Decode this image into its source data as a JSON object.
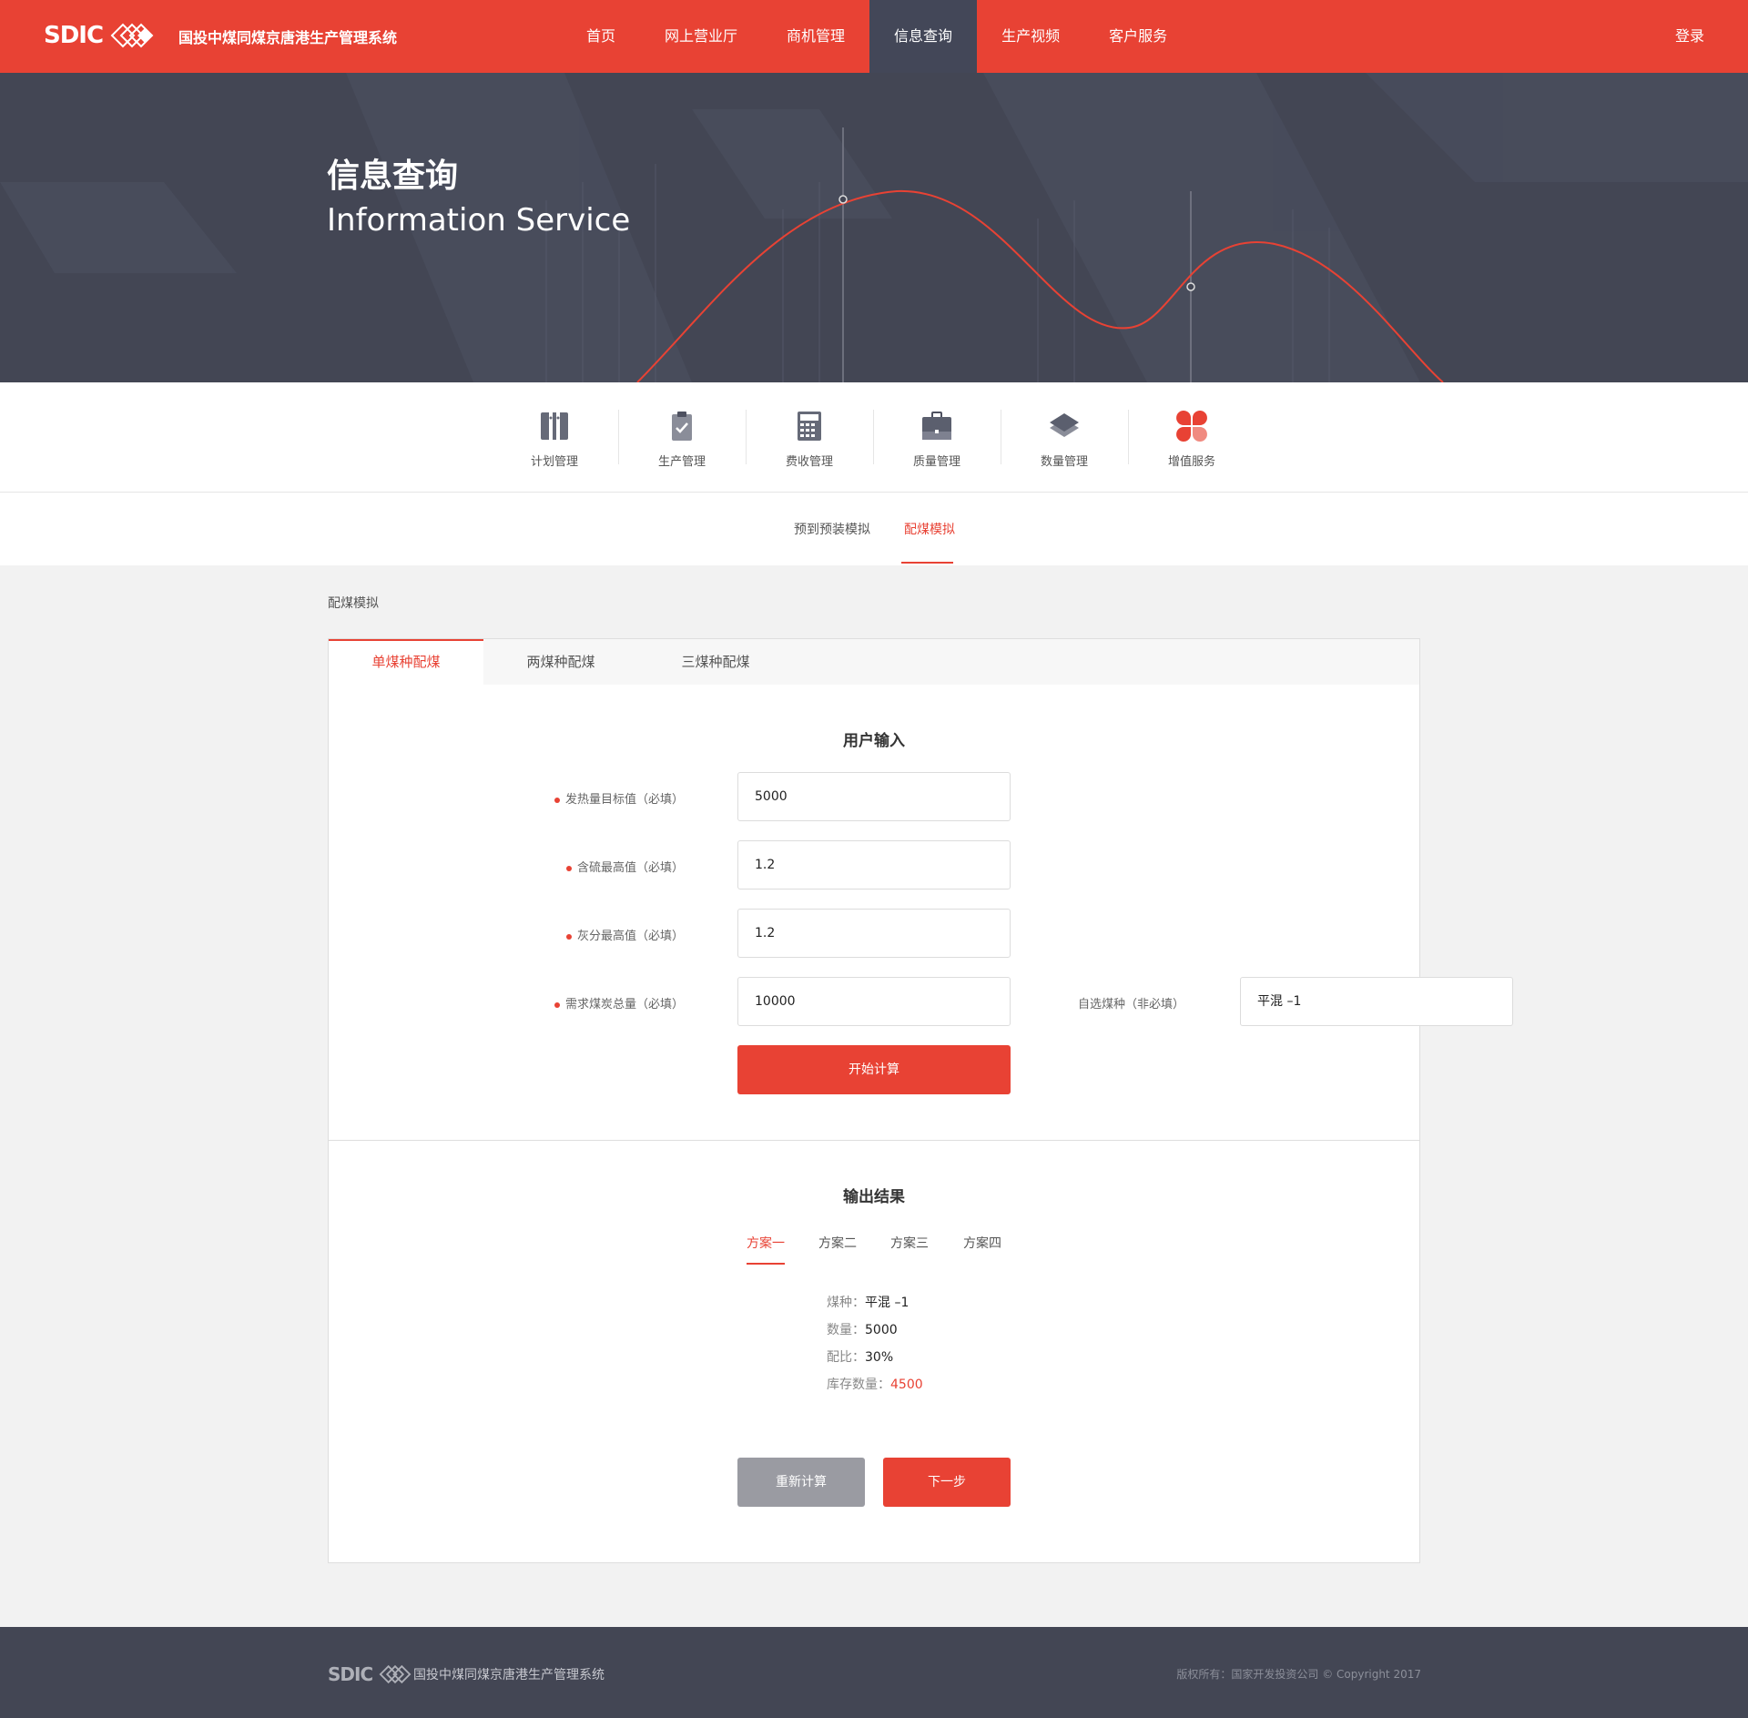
{
  "header": {
    "logo": "SDIC",
    "brand": "国投中煤同煤京唐港生产管理系统",
    "nav": [
      "首页",
      "网上营业厅",
      "商机管理",
      "信息查询",
      "生产视频",
      "客户服务"
    ],
    "active_nav": "信息查询",
    "login": "登录"
  },
  "banner": {
    "title": "信息查询",
    "subtitle": "Information Service"
  },
  "categories": [
    {
      "label": "计划管理",
      "icon": "columns-icon"
    },
    {
      "label": "生产管理",
      "icon": "clipboard-check-icon"
    },
    {
      "label": "费收管理",
      "icon": "calculator-icon"
    },
    {
      "label": "质量管理",
      "icon": "briefcase-icon"
    },
    {
      "label": "数量管理",
      "icon": "layers-icon"
    },
    {
      "label": "增值服务",
      "icon": "clover-icon"
    }
  ],
  "subtabs": {
    "items": [
      "预到预装模拟",
      "配煤模拟"
    ],
    "active": "配煤模拟"
  },
  "breadcrumb": "配煤模拟",
  "panel": {
    "tabs": [
      "单煤种配煤",
      "两煤种配煤",
      "三煤种配煤"
    ],
    "active_tab": "单煤种配煤",
    "input_title": "用户输入",
    "fields": [
      {
        "label": "发热量目标值（必填）",
        "value": "5000"
      },
      {
        "label": "含硫最高值（必填）",
        "value": "1.2"
      },
      {
        "label": "灰分最高值（必填）",
        "value": "1.2"
      },
      {
        "label": "需求煤炭总量（必填）",
        "value": "10000"
      }
    ],
    "optional_field": {
      "label": "自选煤种（非必填）",
      "value": "平混 –1"
    },
    "calc_button": "开始计算",
    "output_title": "输出结果",
    "plans": [
      "方案一",
      "方案二",
      "方案三",
      "方案四"
    ],
    "active_plan": "方案一",
    "results": [
      {
        "key": "煤种：",
        "value": "平混 –1"
      },
      {
        "key": "数量：",
        "value": "5000"
      },
      {
        "key": "配比：",
        "value": "30%"
      },
      {
        "key": "库存数量：",
        "value": "4500"
      }
    ],
    "recalc_button": "重新计算",
    "next_button": "下一步"
  },
  "footer": {
    "logo": "SDIC",
    "brand": "国投中煤同煤京唐港生产管理系统",
    "copyright": "版权所有：国家开发投资公司 © Copyright 2017"
  },
  "colors": {
    "accent": "#e84234",
    "dark": "#434654"
  }
}
